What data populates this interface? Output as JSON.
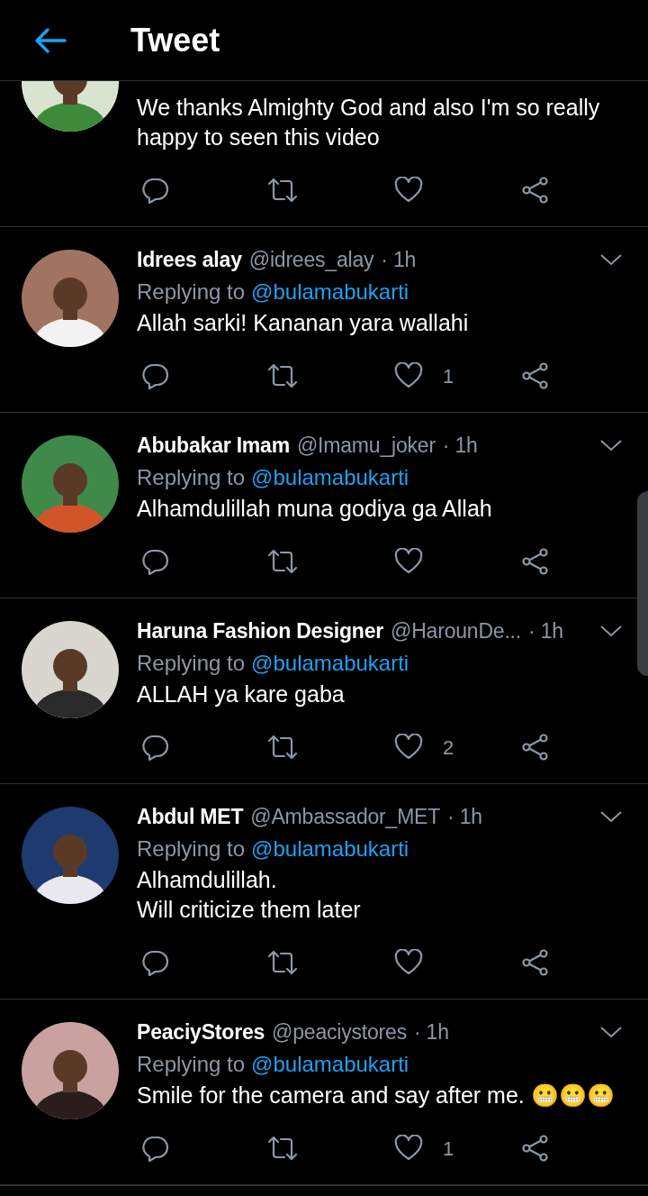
{
  "header": {
    "title": "Tweet"
  },
  "tweets": [
    {
      "kind": "partial",
      "text": [
        "We thanks Almighty God and also I'm so really",
        "happy to seen this video"
      ]
    },
    {
      "kind": "full",
      "name": "Idrees alay",
      "handle": "@idrees_alay",
      "time": "· 1h",
      "replying_label": "Replying to",
      "replying_to": "@bulamabukarti",
      "text": [
        "Allah sarki! Kananan yara wallahi"
      ],
      "likes": "1"
    },
    {
      "kind": "full",
      "name": "Abubakar Imam",
      "handle": "@Imamu_joker",
      "time": "· 1h",
      "replying_label": "Replying to",
      "replying_to": "@bulamabukarti",
      "text": [
        "Alhamdulillah muna godiya ga Allah"
      ]
    },
    {
      "kind": "full",
      "name": "Haruna Fashion Designer",
      "handle": "@HarounDe...",
      "time": "· 1h",
      "replying_label": "Replying to",
      "replying_to": "@bulamabukarti",
      "text": [
        "ALLAH ya kare gaba"
      ],
      "likes": "2"
    },
    {
      "kind": "full",
      "name": "Abdul MET",
      "handle": "@Ambassador_MET",
      "time": "· 1h",
      "replying_label": "Replying to",
      "replying_to": "@bulamabukarti",
      "text": [
        "Alhamdulillah.",
        "Will criticize them later"
      ]
    },
    {
      "kind": "full",
      "name": "PeaciyStores",
      "handle": "@peaciystores",
      "time": "· 1h",
      "replying_label": "Replying to",
      "replying_to": "@bulamabukarti",
      "text": [
        "Smile for the camera and say after me. 😬😬😬"
      ],
      "likes": "1"
    }
  ]
}
